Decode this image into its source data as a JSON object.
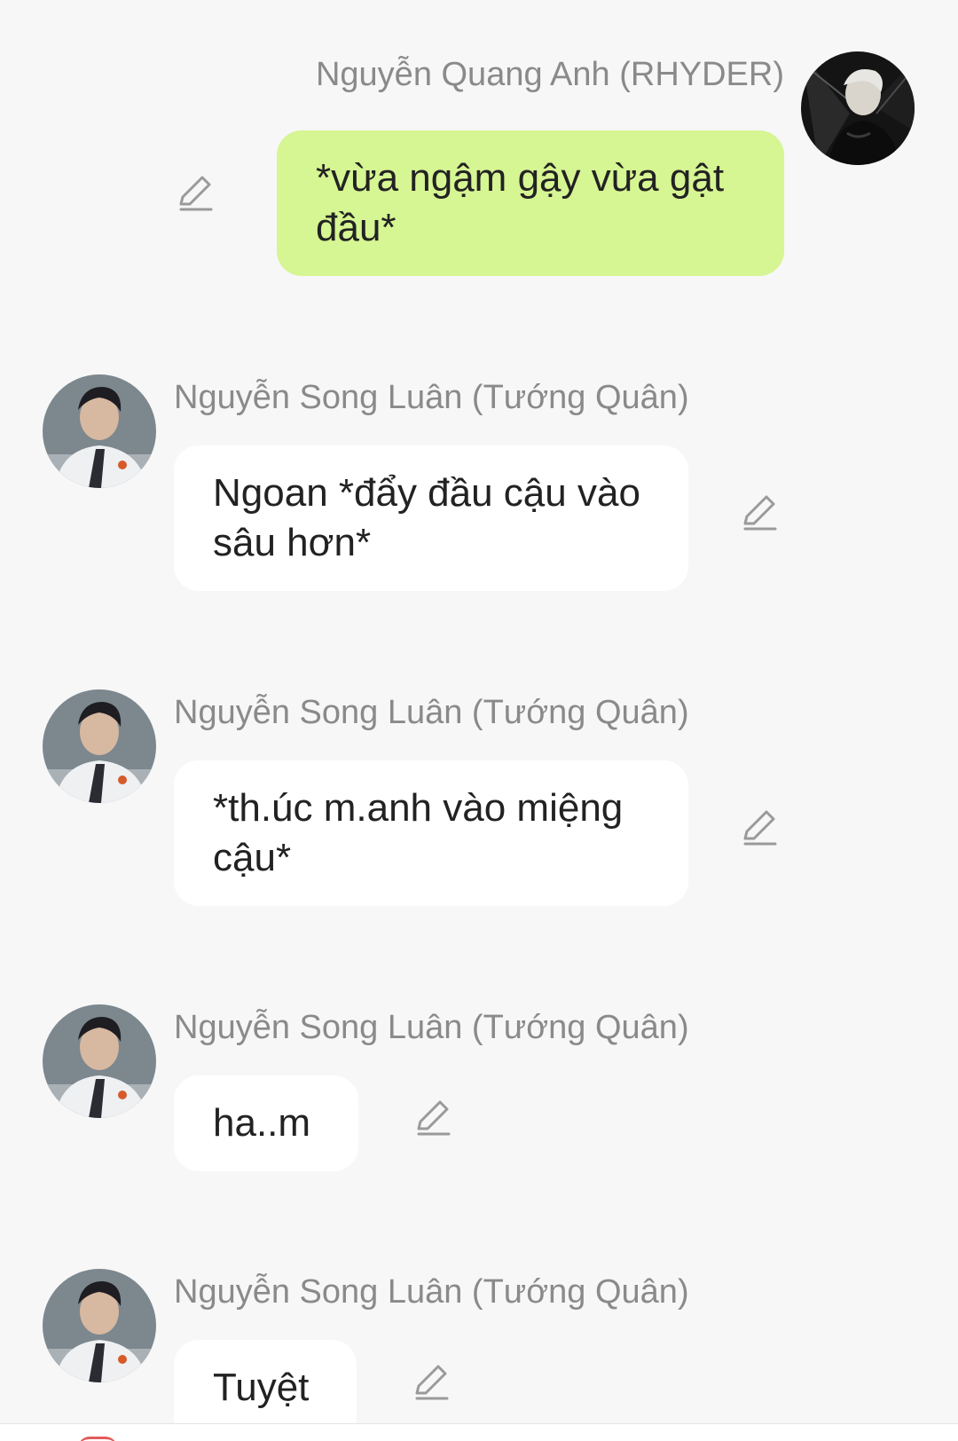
{
  "messages": [
    {
      "sender": "Nguyễn Quang Anh (RHYDER)",
      "text": "*vừa ngậm gậy vừa gật đầu*",
      "side": "right",
      "avatar_icon": "profile-photo-rhyder"
    },
    {
      "sender": "Nguyễn Song Luân (Tướng Quân)",
      "text": "Ngoan *đẩy đầu cậu vào sâu hơn*",
      "side": "left",
      "avatar_icon": "profile-photo-tuong-quan"
    },
    {
      "sender": "Nguyễn Song Luân (Tướng Quân)",
      "text": "*th.úc m.anh vào miệng cậu*",
      "side": "left",
      "avatar_icon": "profile-photo-tuong-quan"
    },
    {
      "sender": "Nguyễn Song Luân (Tướng Quân)",
      "text": "ha..m",
      "side": "left",
      "avatar_icon": "profile-photo-tuong-quan"
    },
    {
      "sender": "Nguyễn Song Luân (Tướng Quân)",
      "text": "Tuyệt",
      "side": "left",
      "avatar_icon": "profile-photo-tuong-quan"
    }
  ],
  "colors": {
    "background": "#f7f7f7",
    "my_bubble": "#d6f593",
    "their_bubble": "#ffffff",
    "sender_name": "#8a8a8a",
    "message_text": "#222222",
    "edit_icon": "#9a9a9a"
  },
  "icons": {
    "edit": "pencil-edit-icon"
  }
}
